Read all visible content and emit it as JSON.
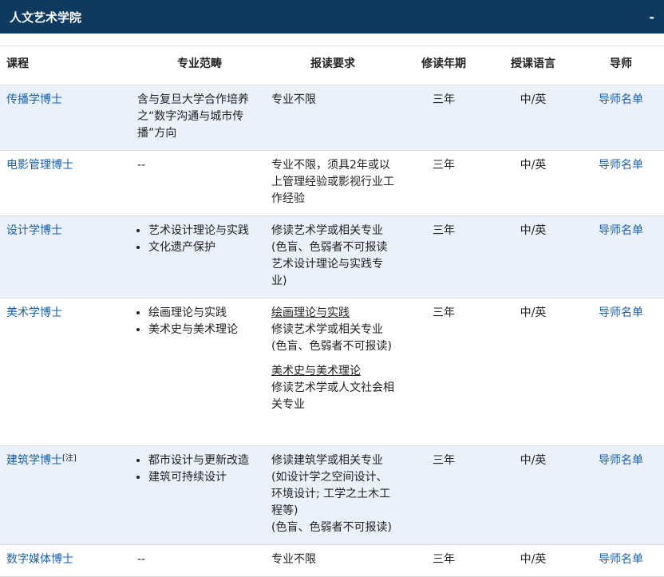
{
  "header": {
    "title": "人文艺术学院",
    "toggle": "-"
  },
  "columns": [
    "课程",
    "专业范畴",
    "报读要求",
    "修读年期",
    "授课语言",
    "导师"
  ],
  "rows": [
    {
      "course": "传播学博士",
      "scope_text": "含与复旦大学合作培养之“数字沟通与城市传播”方向",
      "req_lines": [
        "专业不限"
      ],
      "years": "三年",
      "lang": "中/英",
      "tutor": "导师名单"
    },
    {
      "course": "电影管理博士",
      "scope_text": "--",
      "req_lines": [
        "专业不限，须具2年或以上管理经验或影视行业工作经验"
      ],
      "years": "三年",
      "lang": "中/英",
      "tutor": "导师名单"
    },
    {
      "course": "设计学博士",
      "scope_list": [
        "艺术设计理论与实践",
        "文化遗产保护"
      ],
      "req_lines": [
        "修读艺术学或相关专业",
        "(色盲、色弱者不可报读艺术设计理论与实践专业)"
      ],
      "years": "三年",
      "lang": "中/英",
      "tutor": "导师名单"
    },
    {
      "course": "美术学博士",
      "scope_list": [
        "绘画理论与实践",
        "美术史与美术理论"
      ],
      "req_sections": [
        {
          "heading": "绘画理论与实践",
          "lines": [
            "修读艺术学或相关专业",
            "(色盲、色弱者不可报读)"
          ]
        },
        {
          "heading": "美术史与美术理论",
          "lines": [
            "修读艺术学或人文社会相关专业"
          ]
        }
      ],
      "years": "三年",
      "lang": "中/英",
      "tutor": "导师名单"
    },
    {
      "course": "建筑学博士",
      "course_note": "[注]",
      "scope_list": [
        "都市设计与更新改造",
        "建筑可持续设计"
      ],
      "req_lines": [
        "修读建筑学或相关专业",
        "(如设计学之空间设计、环境设计; 工学之土木工程等)",
        "(色盲、色弱者不可报读)"
      ],
      "years": "三年",
      "lang": "中/英",
      "tutor": "导师名单"
    },
    {
      "course": "数字媒体博士",
      "scope_text": "--",
      "req_lines": [
        "专业不限"
      ],
      "years": "三年",
      "lang": "中/英",
      "tutor": "导师名单"
    }
  ]
}
